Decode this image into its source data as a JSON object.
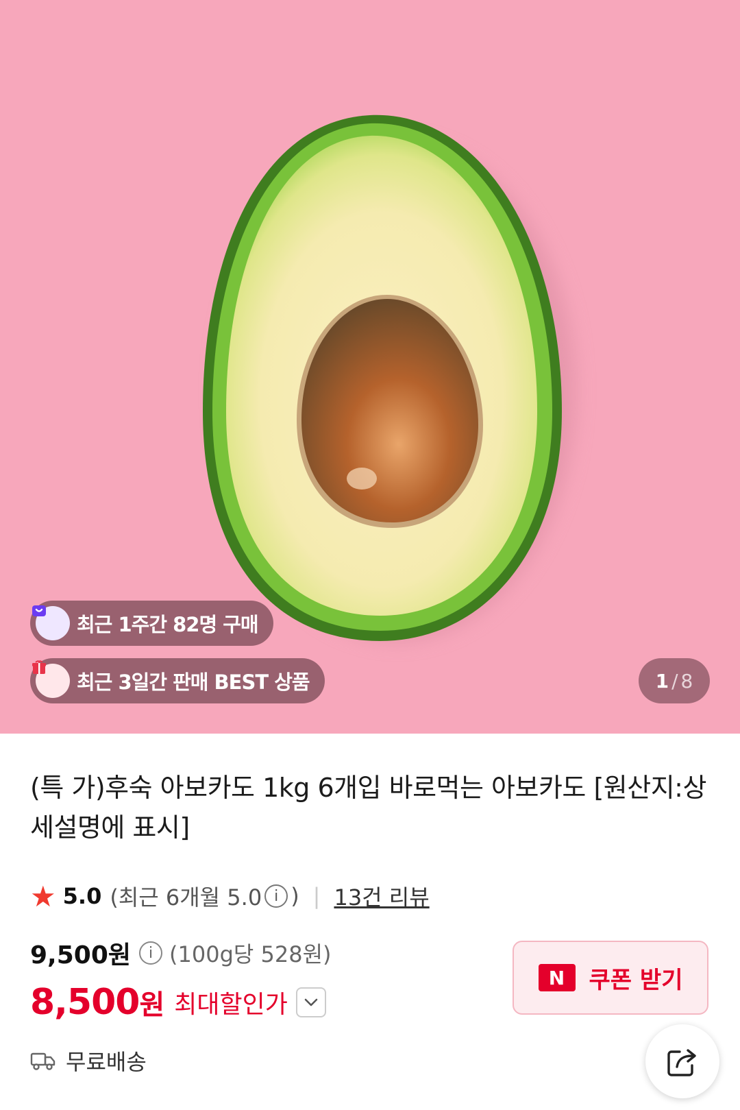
{
  "hero": {
    "image_alt": "avocado-half-photo",
    "badges": [
      {
        "text": "최근 1주간 82명 구매",
        "icon": "shopping-bag-icon",
        "icon_color": "#6b3cf2"
      },
      {
        "text": "최근 3일간 판매 BEST 상품",
        "icon": "gift-icon",
        "icon_color": "#e8344a"
      }
    ],
    "counter": {
      "current": "1",
      "separator": "/",
      "total": "8"
    }
  },
  "product": {
    "title": "(특 가)후숙 아보카도 1kg 6개입 바로먹는 아보카도 [원산지:상세설명에 표시]",
    "rating": {
      "star_icon": "star-icon",
      "score": "5.0",
      "recent_prefix": "(최근 6개월 5.0",
      "info_glyph": "i",
      "recent_suffix": ")",
      "divider": "|",
      "reviews": "13건 리뷰"
    },
    "price": {
      "original": "9,500원",
      "info_glyph": "i",
      "unit_price": "(100g당 528원)",
      "sale_value": "8,500",
      "sale_won": "원",
      "sale_label": "최대할인가"
    },
    "coupon": {
      "logo": "N",
      "label": "쿠폰 받기"
    },
    "shipping": "무료배송"
  },
  "colors": {
    "accent": "#e4002b",
    "hero_bg": "#f7a7bb"
  }
}
